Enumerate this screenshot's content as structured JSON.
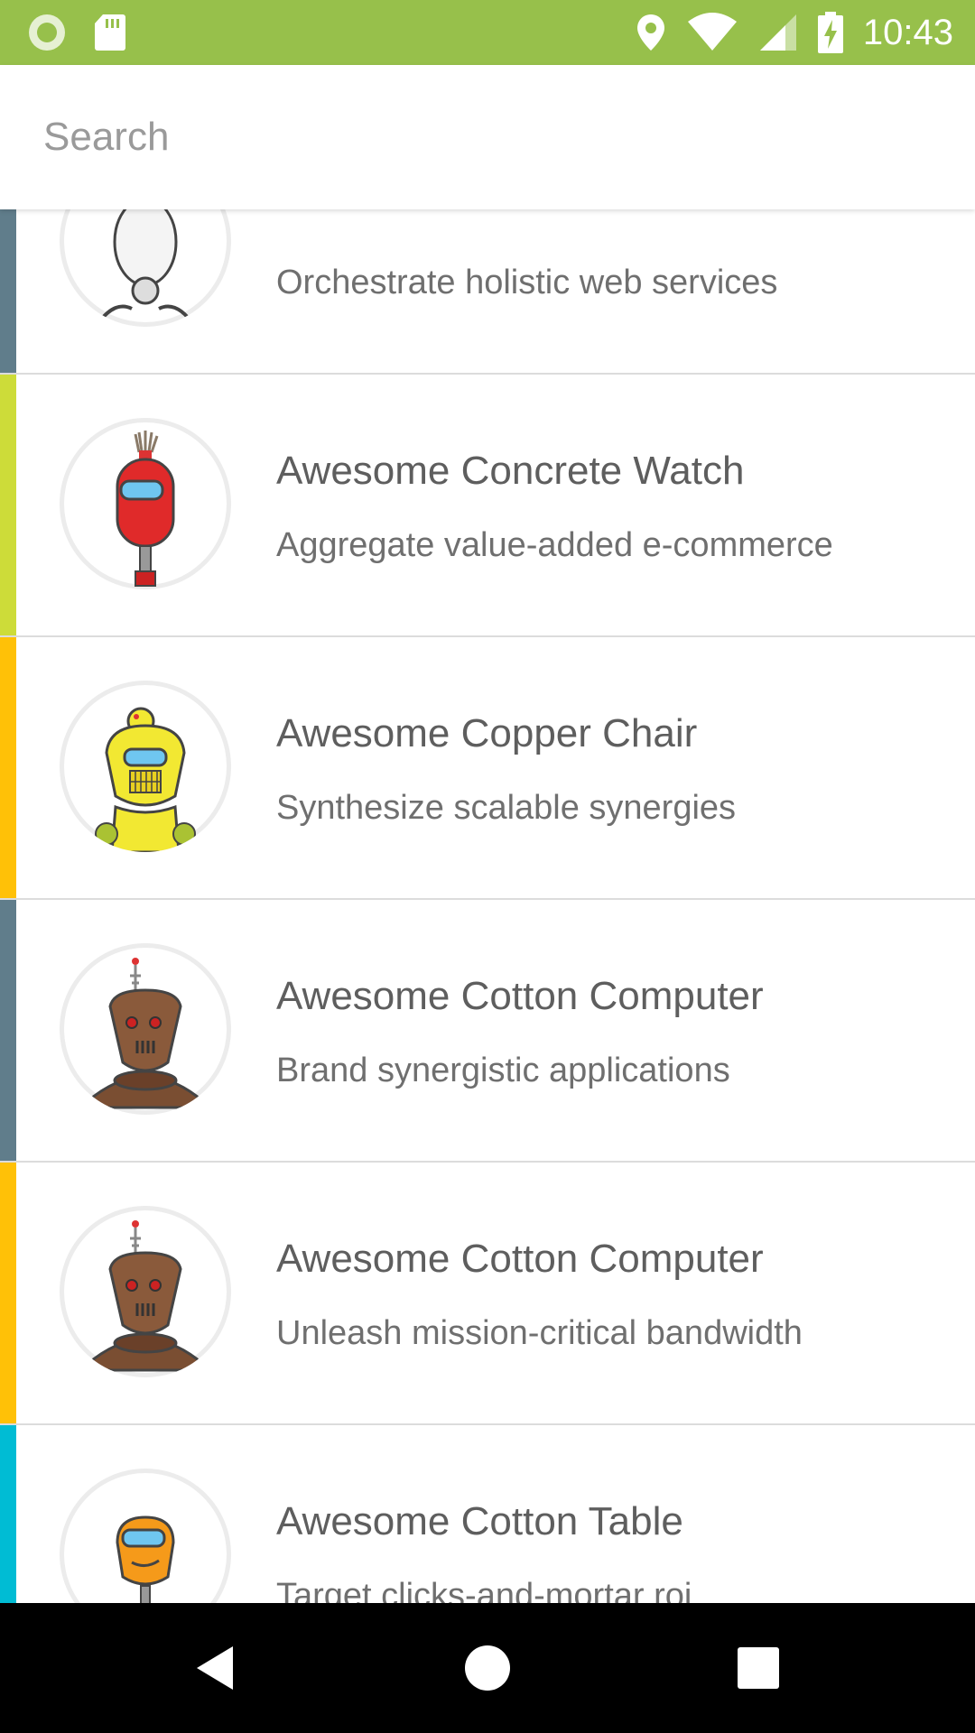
{
  "status_bar": {
    "time": "10:43",
    "left_icons": [
      "circle-notification-icon",
      "sd-card-icon"
    ],
    "right_icons": [
      "location-icon",
      "wifi-icon",
      "cell-signal-icon",
      "battery-charging-icon"
    ],
    "color": "#97c04b"
  },
  "search": {
    "placeholder": "Search",
    "value": ""
  },
  "list": {
    "items": [
      {
        "title": "",
        "subtitle": "Orchestrate holistic web services",
        "color": "#607d8b",
        "avatar": "white-robot-icon"
      },
      {
        "title": "Awesome Concrete Watch",
        "subtitle": "Aggregate value-added e-commerce",
        "color": "#cddc39",
        "avatar": "red-robot-icon"
      },
      {
        "title": "Awesome Copper Chair",
        "subtitle": "Synthesize scalable synergies",
        "color": "#ffc107",
        "avatar": "yellow-robot-icon"
      },
      {
        "title": "Awesome Cotton Computer",
        "subtitle": "Brand synergistic applications",
        "color": "#607d8b",
        "avatar": "brown-robot-icon"
      },
      {
        "title": "Awesome Cotton Computer",
        "subtitle": "Unleash mission-critical bandwidth",
        "color": "#ffc107",
        "avatar": "brown-robot-icon"
      },
      {
        "title": "Awesome Cotton Table",
        "subtitle": "Target clicks-and-mortar roi",
        "color": "#00bcd4",
        "avatar": "orange-robot-icon"
      }
    ]
  },
  "nav_bar": {
    "buttons": [
      "back-icon",
      "home-icon",
      "recents-icon"
    ]
  }
}
